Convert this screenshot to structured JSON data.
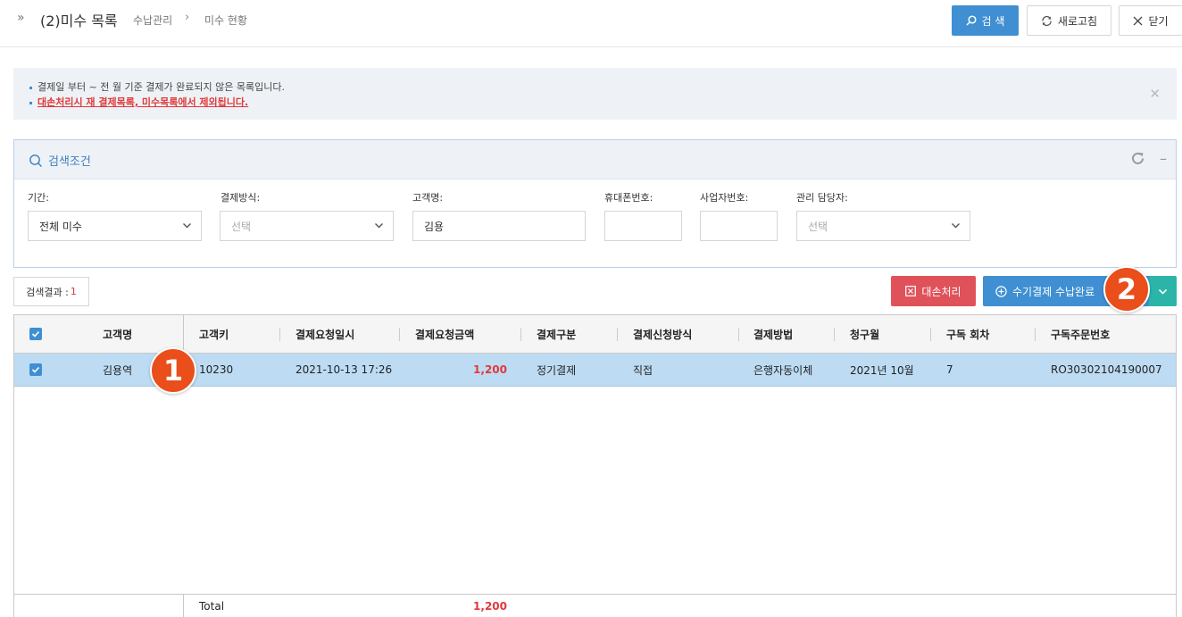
{
  "header": {
    "title": "(2)미수 목록",
    "breadcrumb": [
      "수납관리",
      "미수 현황"
    ],
    "search_button": "검 색",
    "refresh_button": "새로고침",
    "close_button": "닫기"
  },
  "notice": {
    "line1": "결제일 부터 ~ 전 월 기준 결제가 완료되지 않은 목록입니다.",
    "line2": "대손처리시 재 결제목록, 미수목록에서 제외됩니다."
  },
  "search_panel": {
    "title": "검색조건",
    "fields": {
      "period": {
        "label": "기간:",
        "value": "전체 미수"
      },
      "pay_method": {
        "label": "결제방식:",
        "placeholder": "선택"
      },
      "customer": {
        "label": "고객명:",
        "value": "김용"
      },
      "phone": {
        "label": "휴대폰번호:",
        "value": ""
      },
      "biz_no": {
        "label": "사업자번호:",
        "value": ""
      },
      "manager": {
        "label": "관리 담당자:",
        "placeholder": "선택"
      }
    }
  },
  "results": {
    "label": "검색결과 :",
    "count": "1",
    "loan_button": "대손처리",
    "manual_button": "수기결제 수납완료"
  },
  "table": {
    "columns": [
      "고객명",
      "고객키",
      "결제요청일시",
      "결제요청금액",
      "결제구분",
      "결제신청방식",
      "결제방법",
      "청구월",
      "구독 회차",
      "구독주문번호"
    ],
    "rows": [
      {
        "customer": "김용역",
        "key": "10230",
        "datetime": "2021-10-13 17:26",
        "amount": "1,200",
        "type": "정기결제",
        "apply": "직접",
        "method": "은행자동이체",
        "month": "2021년 10월",
        "round": "7",
        "order_no": "RO30302104190007"
      }
    ],
    "footer": {
      "label": "Total",
      "amount": "1,200"
    }
  },
  "badges": [
    "1",
    "2"
  ],
  "colors": {
    "primary": "#3f8fd2",
    "danger": "#e0525a",
    "teal": "#2bb5a8",
    "row_selected": "#bddcf3",
    "badge": "#e94e1b"
  }
}
